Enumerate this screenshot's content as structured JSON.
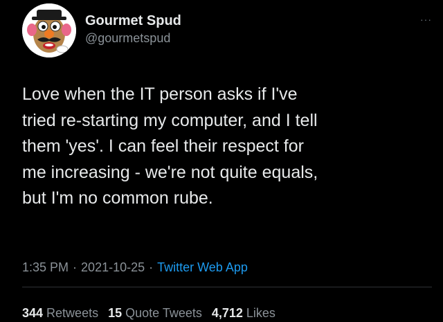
{
  "tweet": {
    "display_name": "Gourmet Spud",
    "handle": "@gourmetspud",
    "text": "Love when the IT person asks if I've\ntried re-starting my computer, and I tell\nthem 'yes'. I can feel their respect for\nme increasing - we're not quite equals,\nbut I'm no common rube.",
    "time": "1:35 PM",
    "date": "2021-10-25",
    "separator": "·",
    "source": "Twitter Web App",
    "more_icon": "···"
  },
  "stats": {
    "retweets_count": "344",
    "retweets_label": "Retweets",
    "quote_count": "15",
    "quote_label": "Quote Tweets",
    "likes_count": "4,712",
    "likes_label": "Likes"
  },
  "colors": {
    "background": "#000000",
    "text": "#e7e9ea",
    "secondary": "#8b9298",
    "link": "#1d9bf0",
    "divider": "#2f3336"
  },
  "icons": {
    "avatar": "potato-head-avatar",
    "more": "more-dots-icon"
  }
}
